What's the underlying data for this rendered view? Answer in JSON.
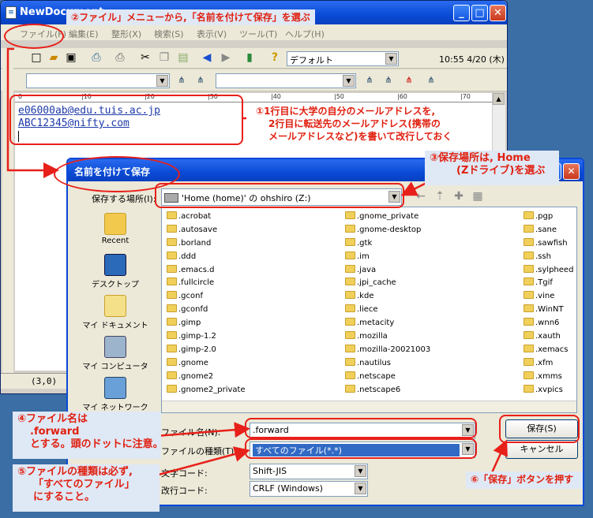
{
  "editor": {
    "title": "NewDocument",
    "menu": [
      "ファイル(F)",
      "編集(E)",
      "整形(X)",
      "検索(S)",
      "表示(V)",
      "ツール(T)",
      "ヘルプ(H)"
    ],
    "style_combo": "デフォルト",
    "clock": "10:55 4/20 (木)",
    "lines": [
      "e06000ab@edu.tuis.ac.jp",
      "ABC12345@nifty.com"
    ],
    "status": "(3,0)"
  },
  "dialog": {
    "title": "名前を付けて保存",
    "save_in_label": "保存する場所(I):",
    "save_in_value": "'Home (home)' の ohshiro (Z:)",
    "places": [
      "Recent",
      "デスクトップ",
      "マイ ドキュメント",
      "マイ コンピュータ",
      "マイ ネットワーク"
    ],
    "files_col1": [
      ".acrobat",
      ".autosave",
      ".borland",
      ".ddd",
      ".emacs.d",
      ".fullcircle",
      ".gconf",
      ".gconfd",
      ".gimp",
      ".gimp-1.2",
      ".gimp-2.0",
      ".gnome",
      ".gnome2",
      ".gnome2_private"
    ],
    "files_col2": [
      ".gnome_private",
      ".gnome-desktop",
      ".gtk",
      ".im",
      ".java",
      ".jpi_cache",
      ".kde",
      ".liece",
      ".metacity",
      ".mozilla",
      ".mozilla-20021003",
      ".nautilus",
      ".netscape",
      ".netscape6"
    ],
    "files_col3": [
      ".pgp",
      ".sane",
      ".sawfish",
      ".ssh",
      ".sylpheed",
      ".Tgif",
      ".vine",
      ".WinNT",
      ".wnn6",
      ".xauth",
      ".xemacs",
      ".xfm",
      ".xmms",
      ".xvpics"
    ],
    "filename_label": "ファイル名(N):",
    "filename_value": ".forward",
    "filetype_label": "ファイルの種類(T):",
    "filetype_value": "すべてのファイル(*.*)",
    "charcode_label": "文字コード:",
    "charcode_value": "Shift-JIS",
    "newline_label": "改行コード:",
    "newline_value": "CRLF (Windows)",
    "save_button": "保存(S)",
    "cancel_button": "キャンセル"
  },
  "annotations": {
    "a1_lines": [
      "①1行目に大学の自分のメールアドレスを,",
      "2行目に転送先のメールアドレス(携帯の",
      "メールアドレスなど)を書いて改行しておく"
    ],
    "a2": "②ファイル」メニューから,「名前を付けて保存」を選ぶ",
    "a3_lines": [
      "③保存場所は, Home",
      "(Zドライブ)を選ぶ"
    ],
    "a4_lines": [
      "④ファイル名は",
      ".forward",
      "とする。頭のドットに注意。"
    ],
    "a5_lines": [
      "⑤ファイルの種類は必ず,",
      "「すべてのファイル」",
      "にすること。"
    ],
    "a6": "⑥「保存」ボタンを押す"
  },
  "colors": {
    "annotation": "#e8201a",
    "titlebar": "#0a4bd6",
    "text_link": "#1e3aa8"
  }
}
